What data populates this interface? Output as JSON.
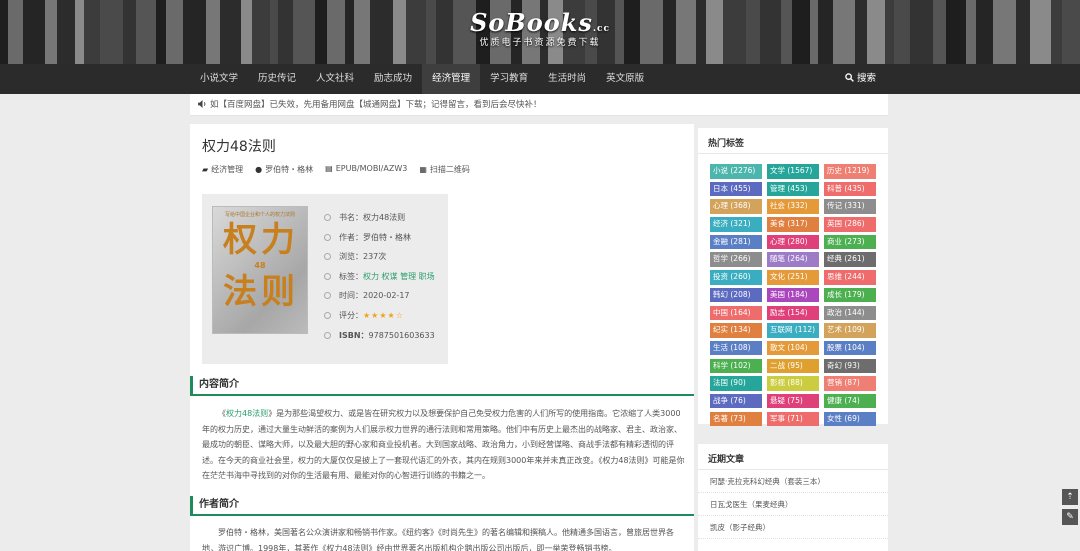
{
  "header": {
    "logo": "SoBooks",
    "logo_suffix": ".cc",
    "tagline": "优质电子书资源免费下载"
  },
  "nav": {
    "items": [
      {
        "label": "小说文学",
        "active": false
      },
      {
        "label": "历史传记",
        "active": false
      },
      {
        "label": "人文社科",
        "active": false
      },
      {
        "label": "励志成功",
        "active": false
      },
      {
        "label": "经济管理",
        "active": true
      },
      {
        "label": "学习教育",
        "active": false
      },
      {
        "label": "生活时尚",
        "active": false
      },
      {
        "label": "英文原版",
        "active": false
      }
    ],
    "search_label": "搜索"
  },
  "notice": {
    "text": "如【百度网盘】已失效，先用备用网盘【城通网盘】下载；记得留言，看到后会尽快补！"
  },
  "post": {
    "title": "权力48法则",
    "meta": {
      "category": "经济管理",
      "author": "罗伯特・格林",
      "format": "EPUB/MOBI/AZW3",
      "qrcode": "扫描二维码"
    },
    "cover": {
      "top_text": "写给中国企业和个人的权力法则",
      "line1": "权力",
      "number": "48",
      "line2": "法则"
    },
    "info": {
      "name_label": "书名：",
      "name": "权力48法则",
      "author_label": "作者：",
      "author": "罗伯特・格林",
      "views_label": "浏览：",
      "views": "237次",
      "tags_label": "标签：",
      "tags": "权力 权谋 管理 职场",
      "date_label": "时间：",
      "date": "2020-02-17",
      "rating_label": "评分：",
      "rating_stars": "★★★★☆",
      "rating": 4,
      "isbn_label": "ISBN：",
      "isbn": "9787501603633"
    },
    "intro_heading": "内容简介",
    "intro_p1": "《权力48法则》是为那些渴望权力、或是皆在研究权力以及想要保护自己免受权力危害的人们所写的使用指南。它浓缩了人类3000年的权力历史，通过大量生动鲜活的案例为人们展示权力世界的通行法则和常用策略。他们中有历史上最杰出的战略家、君主、政治家、最成功的朝臣、谋略大师，以及最大胆的野心家和商业投机者。大到国家战略、政治角力，小到经营谋略、商战手法都有精彩透彻的评述。在今天的商业社会里，权力的大厦仅仅是披上了一套现代语汇的外衣，其内在规则3000年来并未真正改变。《权力48法则》可能是你在茫茫书海中寻找到的对你的生活最有用、最能对你的心智进行训练的书籍之一。",
    "author_heading": "作者简介",
    "author_p1": "罗伯特・格林，美国著名公众演讲家和畅销书作家。《纽约客》《时尚先生》的著名编辑和撰稿人。他精通多国语言，曾旅居世界各地，游识广博。1998年，其著作《权力48法则》经由世界著名出版机构企鹅出版公司出版后，即一举荣登畅销书榜。"
  },
  "sidebar": {
    "hot_tags_title": "热门标签",
    "tags": [
      {
        "label": "小说 (2276)",
        "color": "#4db6ac"
      },
      {
        "label": "文学 (1567)",
        "color": "#26a69a"
      },
      {
        "label": "历史 (1219)",
        "color": "#ef7f73"
      },
      {
        "label": "日本 (455)",
        "color": "#5c6bc0"
      },
      {
        "label": "管理 (453)",
        "color": "#26a69a"
      },
      {
        "label": "科普 (435)",
        "color": "#ef6c6c"
      },
      {
        "label": "心理 (368)",
        "color": "#d4a35b"
      },
      {
        "label": "社会 (332)",
        "color": "#e59a3a"
      },
      {
        "label": "传记 (331)",
        "color": "#8d8d8d"
      },
      {
        "label": "经济 (321)",
        "color": "#3aaec0"
      },
      {
        "label": "美食 (317)",
        "color": "#e08040"
      },
      {
        "label": "英国 (286)",
        "color": "#ef6c6c"
      },
      {
        "label": "金融 (281)",
        "color": "#5b7fc4"
      },
      {
        "label": "心理 (280)",
        "color": "#e0407a"
      },
      {
        "label": "商业 (273)",
        "color": "#4caf50"
      },
      {
        "label": "哲学 (266)",
        "color": "#8d8d8d"
      },
      {
        "label": "随笔 (264)",
        "color": "#9e7bc7"
      },
      {
        "label": "经典 (261)",
        "color": "#6d6d6d"
      },
      {
        "label": "投资 (260)",
        "color": "#3aaec0"
      },
      {
        "label": "文化 (251)",
        "color": "#e59a3a"
      },
      {
        "label": "思维 (244)",
        "color": "#ef6c6c"
      },
      {
        "label": "韩幻 (208)",
        "color": "#5c6bc0"
      },
      {
        "label": "美国 (184)",
        "color": "#ab47bc"
      },
      {
        "label": "成长 (179)",
        "color": "#4caf50"
      },
      {
        "label": "中国 (164)",
        "color": "#ef6c6c"
      },
      {
        "label": "励志 (154)",
        "color": "#e0407a"
      },
      {
        "label": "政治 (144)",
        "color": "#8d8d8d"
      },
      {
        "label": "纪实 (134)",
        "color": "#e08040"
      },
      {
        "label": "互联网 (112)",
        "color": "#3aaec0"
      },
      {
        "label": "艺术 (109)",
        "color": "#d4a35b"
      },
      {
        "label": "生活 (108)",
        "color": "#5b7fc4"
      },
      {
        "label": "散文 (104)",
        "color": "#e59a3a"
      },
      {
        "label": "股票 (104)",
        "color": "#5b7fc4"
      },
      {
        "label": "科学 (102)",
        "color": "#4caf50"
      },
      {
        "label": "二战 (95)",
        "color": "#e0a030"
      },
      {
        "label": "奇幻 (93)",
        "color": "#6d6d6d"
      },
      {
        "label": "法国 (90)",
        "color": "#26a69a"
      },
      {
        "label": "影视 (88)",
        "color": "#cccc40"
      },
      {
        "label": "营销 (87)",
        "color": "#ef7f73"
      },
      {
        "label": "战争 (76)",
        "color": "#5c6bc0"
      },
      {
        "label": "悬疑 (75)",
        "color": "#e0407a"
      },
      {
        "label": "健康 (74)",
        "color": "#4caf50"
      },
      {
        "label": "名著 (73)",
        "color": "#e08040"
      },
      {
        "label": "军事 (71)",
        "color": "#ef6c6c"
      },
      {
        "label": "女性 (69)",
        "color": "#5b7fc4"
      }
    ],
    "recent_title": "近期文章",
    "recent": [
      "阿瑟·克拉克科幻经典（套装三本）",
      "日瓦戈医生（果麦经典）",
      "凯皮（影子经典）"
    ]
  },
  "colors": {
    "accent": "#1f8a5a",
    "link": "#2a9d6b",
    "nav_bg": "#2b2b2b"
  }
}
